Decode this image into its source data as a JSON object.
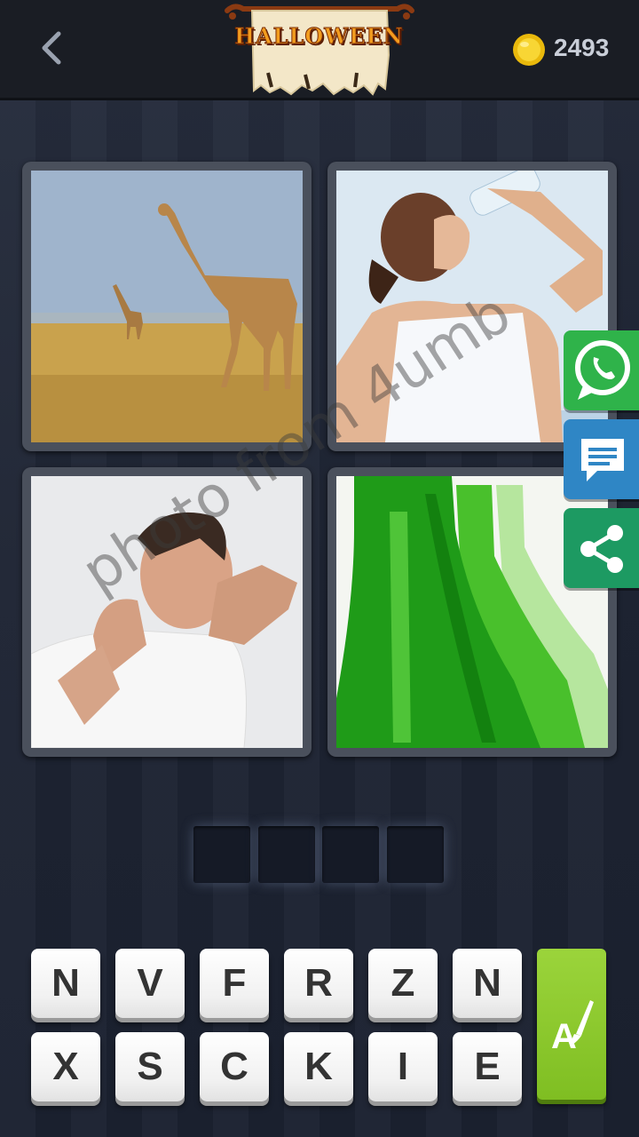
{
  "header": {
    "banner_title": "HALLOWEEN",
    "coins": "2493"
  },
  "pictures": [
    {
      "subject": "giraffes"
    },
    {
      "subject": "woman-drinking-water"
    },
    {
      "subject": "man-neck-pain"
    },
    {
      "subject": "green-bottles"
    }
  ],
  "answer": {
    "length": 4,
    "letters": [
      "",
      "",
      "",
      ""
    ]
  },
  "keyboard": {
    "row1": [
      "N",
      "V",
      "F",
      "R",
      "Z",
      "N"
    ],
    "row2": [
      "X",
      "S",
      "C",
      "K",
      "I",
      "E"
    ]
  },
  "side_buttons": [
    {
      "icon": "whatsapp-icon",
      "color": "#2fb34a"
    },
    {
      "icon": "chat-icon",
      "color": "#2f86c5"
    },
    {
      "icon": "share-icon",
      "color": "#1d9a62"
    }
  ],
  "watermark": "photo from 4umb",
  "colors": {
    "topbar": "#1a1d24",
    "hint": "#8cc832",
    "banner_text": "#f29d1f"
  }
}
